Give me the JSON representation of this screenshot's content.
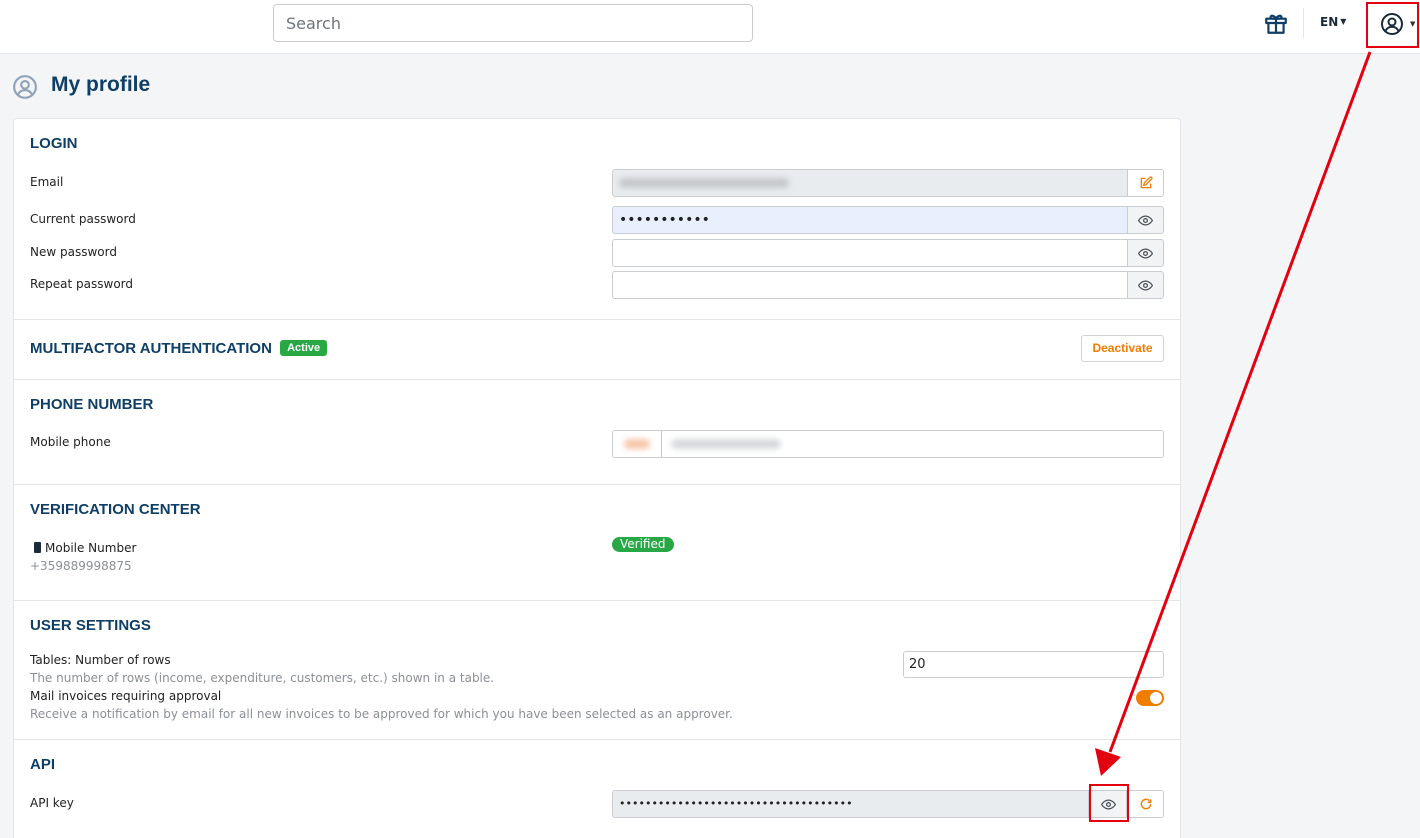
{
  "header": {
    "search_placeholder": "Search",
    "language": "EN"
  },
  "page": {
    "title": "My profile"
  },
  "login": {
    "heading": "LOGIN",
    "email_label": "Email",
    "current_password_label": "Current password",
    "current_password_value": "•••••••••••",
    "new_password_label": "New password",
    "repeat_password_label": "Repeat password"
  },
  "mfa": {
    "heading": "MULTIFACTOR AUTHENTICATION",
    "status_badge": "Active",
    "deactivate_label": "Deactivate"
  },
  "phone": {
    "heading": "PHONE NUMBER",
    "mobile_label": "Mobile phone"
  },
  "verification": {
    "heading": "VERIFICATION CENTER",
    "item_label": "Mobile Number",
    "item_value": "+359889998875",
    "status": "Verified"
  },
  "user_settings": {
    "heading": "USER SETTINGS",
    "rows_label": "Tables: Number of rows",
    "rows_help": "The number of rows (income, expenditure, customers, etc.) shown in a table.",
    "rows_value": "20",
    "mail_label": "Mail invoices requiring approval",
    "mail_help": "Receive a notification by email for all new invoices to be approved for which you have been selected as an approver.",
    "mail_enabled": true
  },
  "api": {
    "heading": "API",
    "key_label": "API key",
    "key_value": "••••••••••••••••••••••••••••••••••••"
  },
  "colors": {
    "accent": "#ef7d00",
    "heading": "#0f3f66",
    "success": "#28a745",
    "annotation": "#e3000f"
  },
  "icons": [
    "gift-icon",
    "user-circle-icon",
    "edit-icon",
    "eye-icon",
    "refresh-icon",
    "mobile-phone-icon"
  ]
}
